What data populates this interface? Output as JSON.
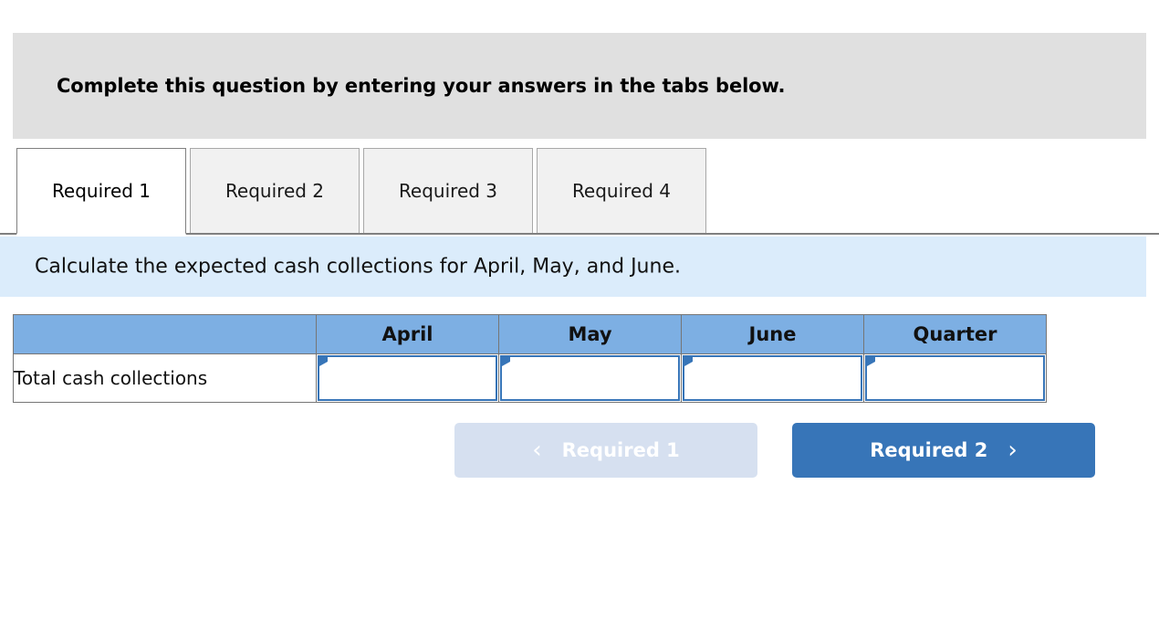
{
  "question_banner": {
    "text": "Complete this question by entering your answers in the tabs below."
  },
  "tabs": [
    {
      "label": "Required 1",
      "active": true
    },
    {
      "label": "Required 2",
      "active": false
    },
    {
      "label": "Required 3",
      "active": false
    },
    {
      "label": "Required 4",
      "active": false
    }
  ],
  "sub_banner": {
    "text": "Calculate the expected cash collections for April, May, and June."
  },
  "table": {
    "headers": [
      "",
      "April",
      "May",
      "June",
      "Quarter"
    ],
    "rows": [
      {
        "label": "Total cash collections",
        "values": [
          "",
          "",
          "",
          ""
        ]
      }
    ]
  },
  "navigation": {
    "prev_label": "Required 1",
    "prev_icon": "chevron-left-icon",
    "prev_glyph": "‹",
    "next_label": "Required 2",
    "next_icon": "chevron-right-icon",
    "next_glyph": "›"
  },
  "colors": {
    "banner_grey": "#e0e0e0",
    "banner_blue": "#dbecfb",
    "table_header_blue": "#7dafe3",
    "accent_blue": "#3775b8",
    "nav_disabled": "#d6e0f0"
  }
}
